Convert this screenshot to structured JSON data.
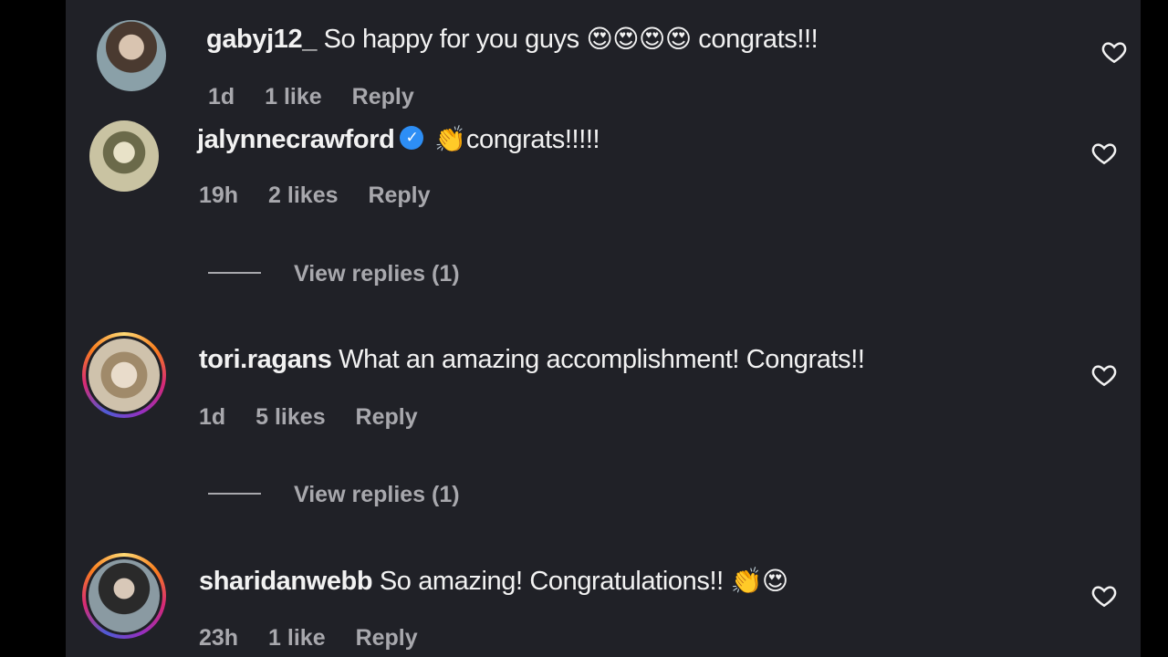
{
  "comments": [
    {
      "username": "gabyj12_",
      "text": "So happy for you guys",
      "emojis": "😍😍😍😍",
      "text_after": "congrats!!!",
      "time": "1d",
      "likes": "1 like",
      "reply": "Reply",
      "avatar_color": "#6b5a4a"
    },
    {
      "username": "jalynnecrawford",
      "verified": "✓",
      "emojis": "👏",
      "text": "congrats!!!!!",
      "time": "19h",
      "likes": "2 likes",
      "reply": "Reply",
      "view_replies": "View replies (1)",
      "avatar_color": "#b8b28a"
    },
    {
      "username": "tori.ragans",
      "text": "What an amazing accomplishment! Congrats!!",
      "time": "1d",
      "likes": "5 likes",
      "reply": "Reply",
      "view_replies": "View replies (1)",
      "avatar_color": "#c9b8a0"
    },
    {
      "username": "sharidanwebb",
      "text": "So amazing! Congratulations!!",
      "emojis": "👏😍",
      "time": "23h",
      "likes": "1 like",
      "reply": "Reply",
      "avatar_color": "#5a6a72"
    }
  ],
  "colors": {
    "background": "#202127",
    "text": "#f2f2f2",
    "muted": "#a8a8ad",
    "verified": "#2d8ef5"
  }
}
